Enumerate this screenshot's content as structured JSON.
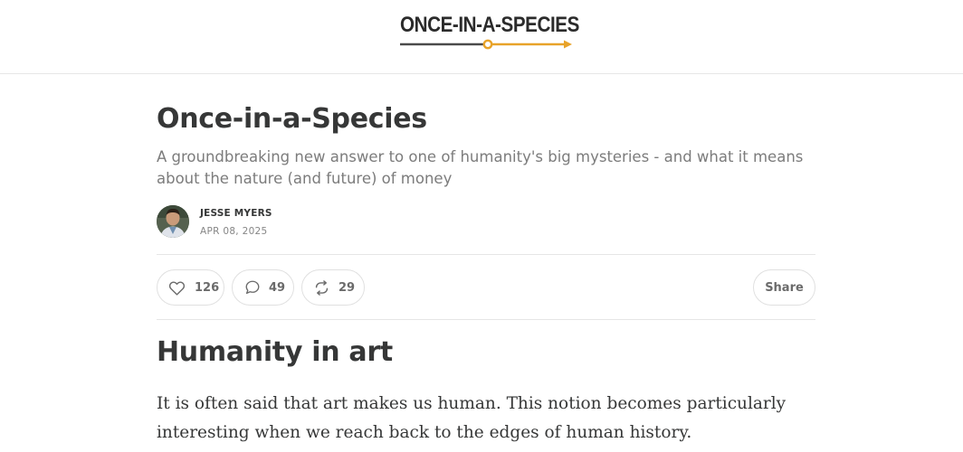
{
  "site": {
    "logo_text": "ONCE-IN-A-SPECIES",
    "logo_accent_color": "#e8a32a",
    "logo_line_color": "#4a4a4a"
  },
  "post": {
    "title": "Once-in-a-Species",
    "subtitle": "A groundbreaking new answer to one of humanity's big mysteries - and what it means about the nature (and future) of money",
    "author": "JESSE MYERS",
    "date": "APR 08, 2025"
  },
  "actions": {
    "likes": "126",
    "comments": "49",
    "restacks": "29",
    "share_label": "Share"
  },
  "content": {
    "heading": "Humanity in art",
    "paragraph": "It is often said that art makes us human. This notion becomes particularly interesting when we reach back to the edges of human history."
  },
  "icons": {
    "like": "heart-icon",
    "comment": "speech-bubble-icon",
    "restack": "restack-arrows-icon"
  }
}
